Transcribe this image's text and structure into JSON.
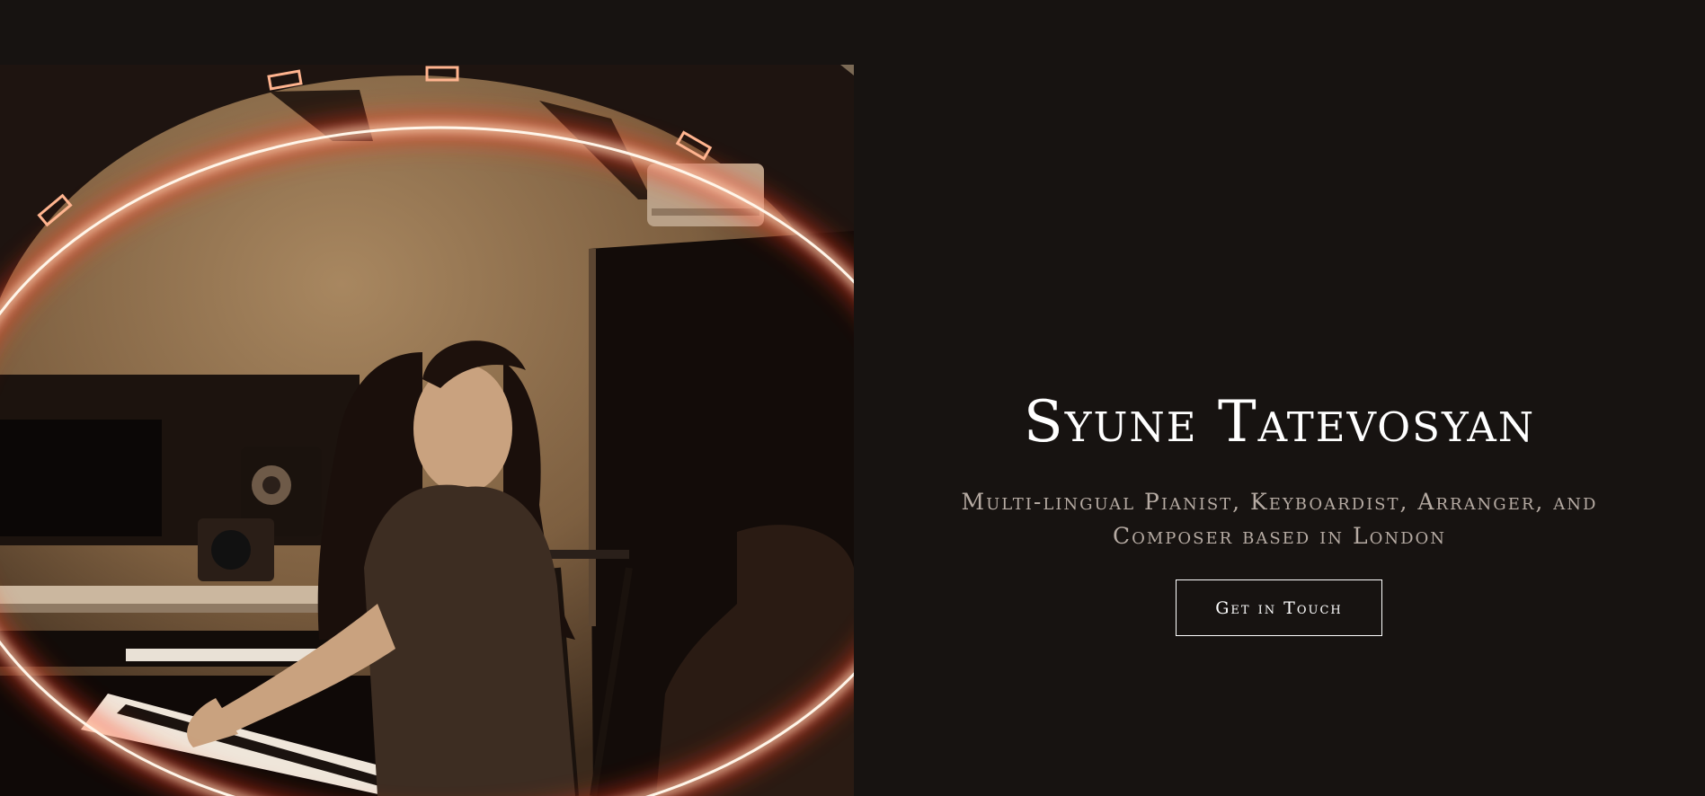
{
  "hero": {
    "title": "Syune Tatevosyan",
    "subtitle": "Multi-lingual Pianist, Keyboardist, Arranger, and Composer based in London",
    "cta_label": "Get in Touch",
    "photo_alt": "Syune Tatevosyan"
  },
  "colors": {
    "background": "#171311",
    "title": "#ffffff",
    "subtitle": "#b6aba3",
    "ring_glow": "#ff3a1f"
  }
}
